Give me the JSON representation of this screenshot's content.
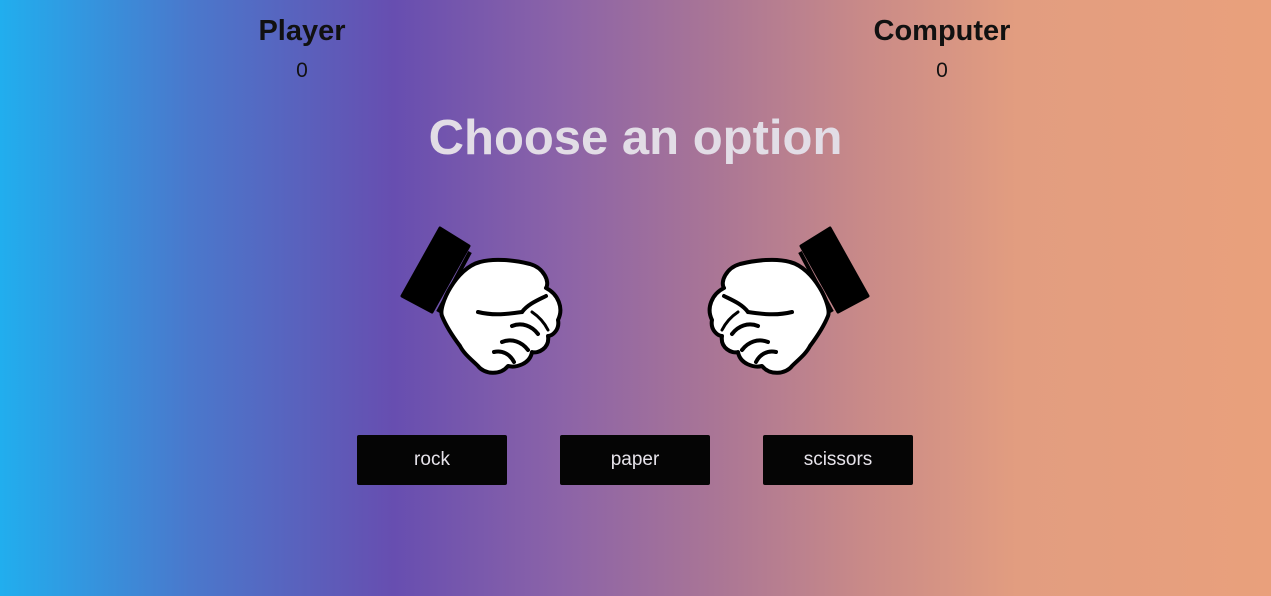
{
  "scoreboard": {
    "player": {
      "label": "Player",
      "score": "0"
    },
    "computer": {
      "label": "Computer",
      "score": "0"
    }
  },
  "headline": "Choose an option",
  "hands": {
    "player": {
      "icon": "rock-fist-icon"
    },
    "computer": {
      "icon": "rock-fist-icon"
    }
  },
  "choices": [
    {
      "label": "rock"
    },
    {
      "label": "paper"
    },
    {
      "label": "scissors"
    }
  ],
  "colors": {
    "gradient": [
      "#21aeee",
      "#674eb0",
      "#c98a88",
      "#e9a07c"
    ],
    "button_bg": "#050505",
    "button_text": "#e6e3ea",
    "headline_text": "#e2dde6"
  }
}
